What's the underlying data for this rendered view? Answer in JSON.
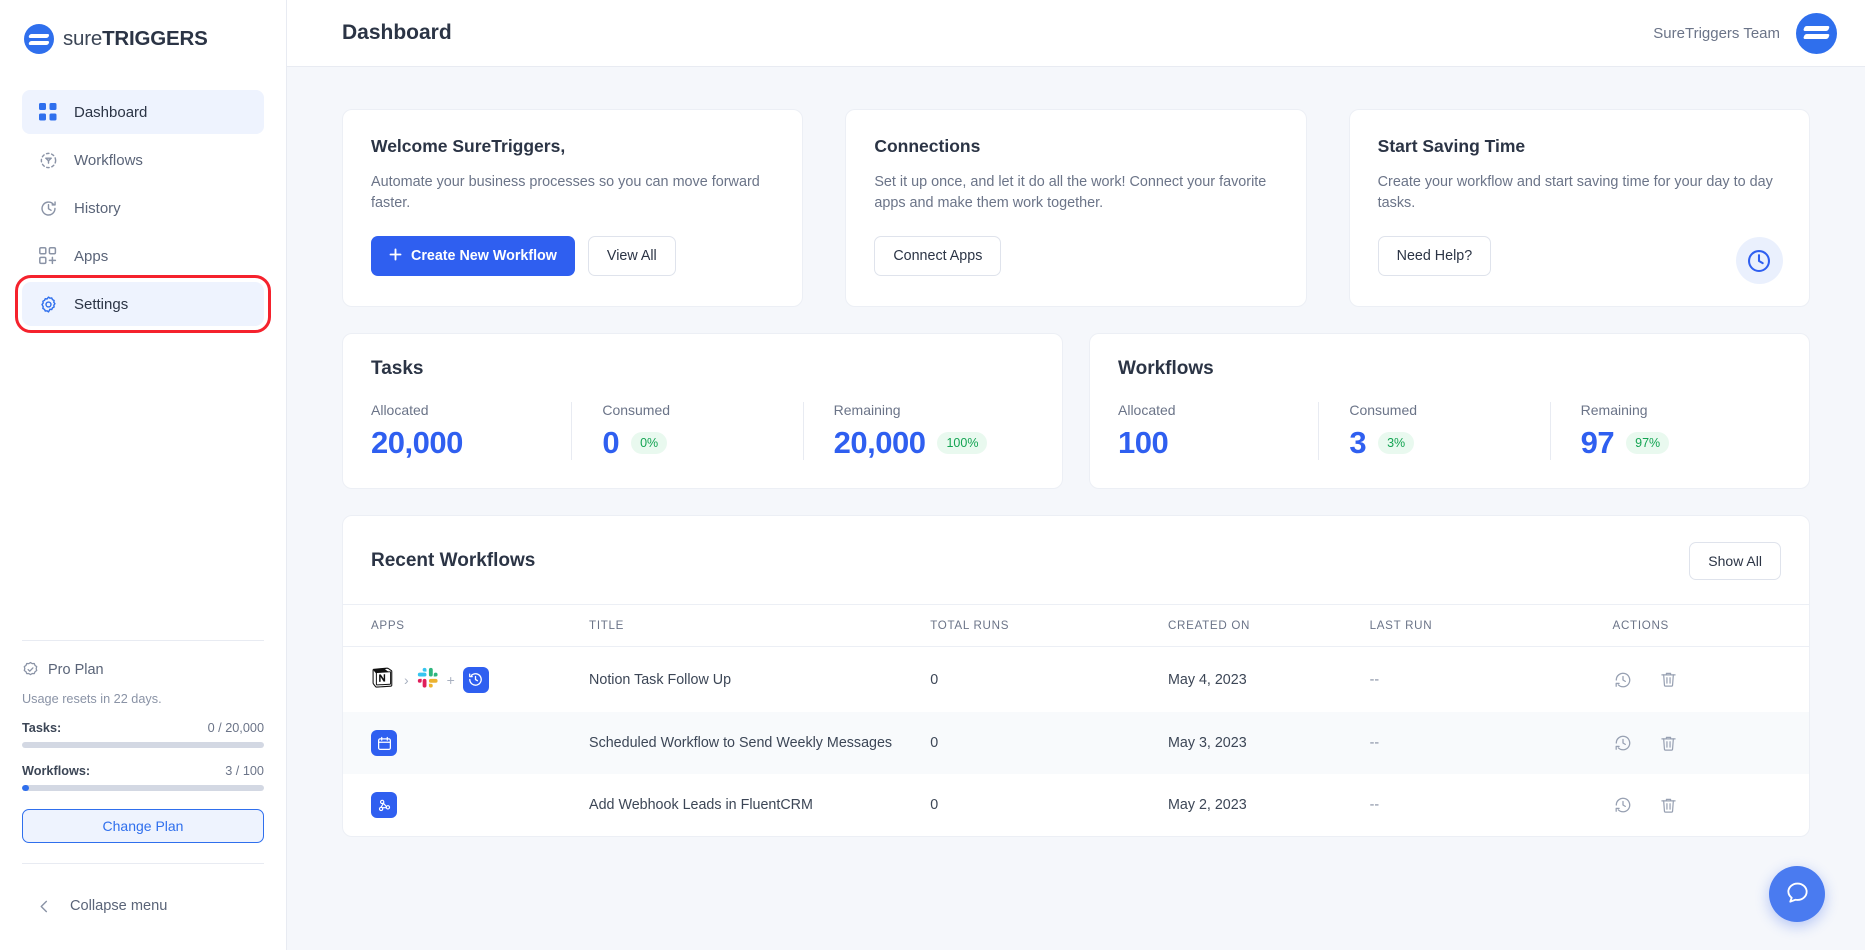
{
  "brand": {
    "logo_light": "sure",
    "logo_bold": "TRIGGERS",
    "logo_icon": "suretriggers-logo-icon"
  },
  "sidebar": {
    "items": [
      {
        "label": "Dashboard",
        "icon": "grid-icon",
        "active": true,
        "highlighted": false
      },
      {
        "label": "Workflows",
        "icon": "workflow-icon",
        "active": false,
        "highlighted": false
      },
      {
        "label": "History",
        "icon": "history-icon",
        "active": false,
        "highlighted": false
      },
      {
        "label": "Apps",
        "icon": "apps-plus-icon",
        "active": false,
        "highlighted": false
      },
      {
        "label": "Settings",
        "icon": "gear-icon",
        "active": true,
        "highlighted": true
      }
    ],
    "plan": {
      "name": "Pro Plan",
      "icon": "check-badge-icon",
      "reset_text": "Usage resets in 22 days.",
      "meters": [
        {
          "label": "Tasks:",
          "value": "0 / 20,000",
          "percent": 0
        },
        {
          "label": "Workflows:",
          "value": "3 / 100",
          "percent": 3
        }
      ],
      "change_plan_label": "Change Plan"
    },
    "collapse_label": "Collapse menu",
    "collapse_icon": "chevron-left-icon"
  },
  "header": {
    "title": "Dashboard",
    "team_name": "SureTriggers Team",
    "avatar_icon": "suretriggers-avatar-icon"
  },
  "promo_cards": [
    {
      "title": "Welcome SureTriggers,",
      "body": "Automate your business processes so you can move forward faster.",
      "primary_label": "Create New Workflow",
      "primary_icon": "plus-icon",
      "secondary_label": "View All",
      "badge_icon": null
    },
    {
      "title": "Connections",
      "body": "Set it up once, and let it do all the work! Connect your favorite apps and make them work together.",
      "primary_label": null,
      "secondary_label": "Connect Apps",
      "badge_icon": null
    },
    {
      "title": "Start Saving Time",
      "body": "Create your workflow and start saving time for your day to day tasks.",
      "primary_label": null,
      "secondary_label": "Need Help?",
      "badge_icon": "clock-icon"
    }
  ],
  "stats": [
    {
      "title": "Tasks",
      "cells": [
        {
          "label": "Allocated",
          "value": "20,000",
          "percent": null
        },
        {
          "label": "Consumed",
          "value": "0",
          "percent": "0%"
        },
        {
          "label": "Remaining",
          "value": "20,000",
          "percent": "100%"
        }
      ]
    },
    {
      "title": "Workflows",
      "cells": [
        {
          "label": "Allocated",
          "value": "100",
          "percent": null
        },
        {
          "label": "Consumed",
          "value": "3",
          "percent": "3%"
        },
        {
          "label": "Remaining",
          "value": "97",
          "percent": "97%"
        }
      ]
    }
  ],
  "recent": {
    "title": "Recent Workflows",
    "show_all_label": "Show All",
    "columns": [
      "APPS",
      "TITLE",
      "TOTAL RUNS",
      "CREATED ON",
      "LAST RUN",
      "ACTIONS"
    ],
    "rows": [
      {
        "apps": [
          "notion-icon",
          "slack-icon",
          "delay-icon"
        ],
        "title": "Notion Task Follow Up",
        "total_runs": "0",
        "created_on": "May 4, 2023",
        "last_run": "--"
      },
      {
        "apps": [
          "schedule-icon"
        ],
        "title": "Scheduled Workflow to Send Weekly Messages",
        "total_runs": "0",
        "created_on": "May 3, 2023",
        "last_run": "--"
      },
      {
        "apps": [
          "webhook-icon"
        ],
        "title": "Add Webhook Leads in FluentCRM",
        "total_runs": "0",
        "created_on": "May 2, 2023",
        "last_run": "--"
      }
    ],
    "action_icons": [
      "history-icon",
      "trash-icon"
    ]
  },
  "fab": {
    "icon": "chat-help-icon"
  },
  "colors": {
    "accent_blue": "#2f5ff0",
    "nav_active_bg": "#eef3fe",
    "success_green": "#13a452",
    "success_bg": "#e9f9ef",
    "highlight_red": "#f5222d",
    "page_bg": "#f5f7fb"
  }
}
